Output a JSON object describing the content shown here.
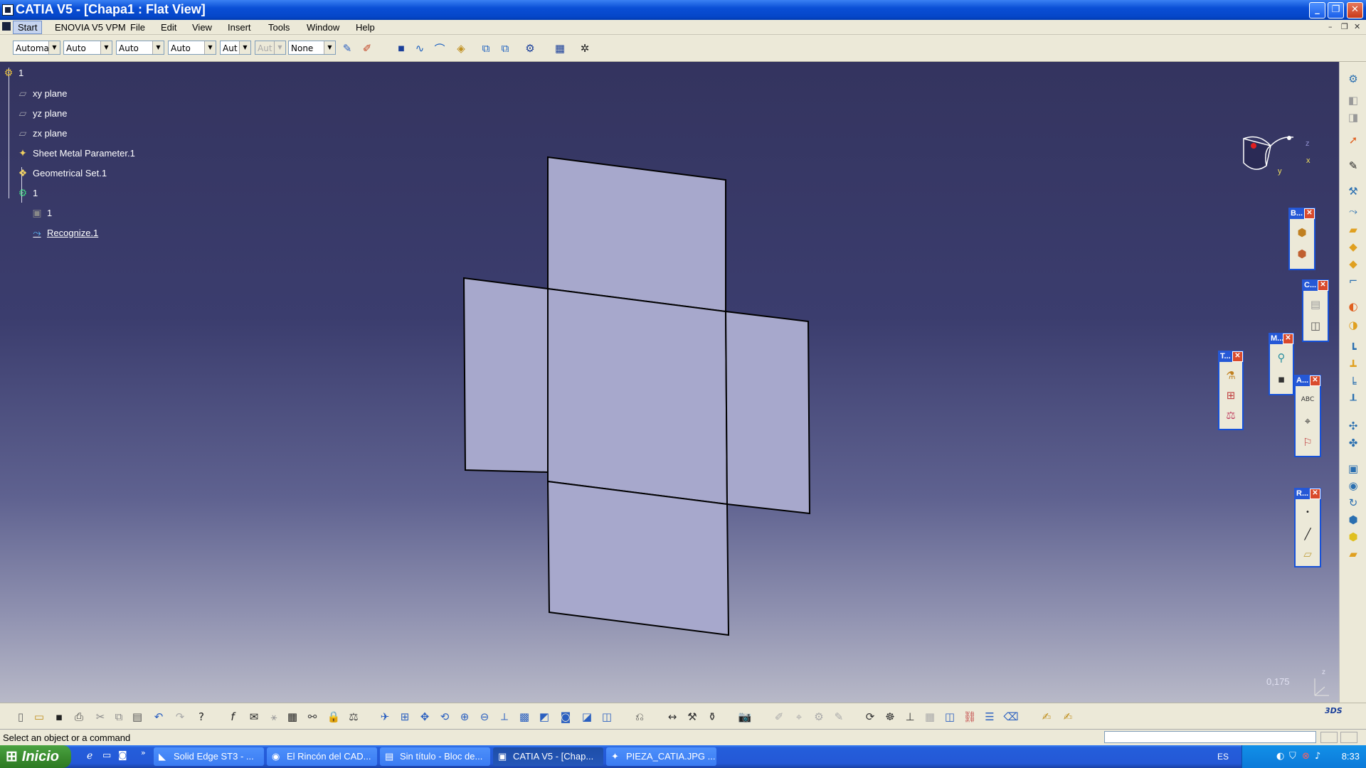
{
  "window": {
    "title": "CATIA V5 - [Chapa1 : Flat View]"
  },
  "menu": {
    "items": [
      "Start",
      "ENOVIA V5 VPM",
      "File",
      "Edit",
      "View",
      "Insert",
      "Tools",
      "Window",
      "Help"
    ]
  },
  "toolbar": {
    "combos": [
      "Automa",
      "Auto",
      "Auto",
      "Auto",
      "Aut",
      "Aut",
      "None"
    ]
  },
  "tree": {
    "root": "1",
    "items": [
      "xy plane",
      "yz plane",
      "zx plane",
      "Sheet Metal Parameter.1",
      "Geometrical Set.1",
      "1",
      "1",
      "Recognize.1"
    ]
  },
  "compass": {
    "x": "x",
    "y": "y",
    "z": "z"
  },
  "palettes": [
    {
      "label": "B..."
    },
    {
      "label": "C..."
    },
    {
      "label": "M..."
    },
    {
      "label": "T..."
    },
    {
      "label": "A..."
    },
    {
      "label": "R..."
    }
  ],
  "viewport": {
    "scale": "0,175",
    "triad_z": "z"
  },
  "status": {
    "text": "Select an object or a command"
  },
  "taskbar": {
    "start": "Inicio",
    "tasks": [
      "Solid Edge ST3 - ...",
      "El Rincón del CAD...",
      "Sin título - Bloc de...",
      "CATIA V5 - [Chap...",
      "PIEZA_CATIA.JPG ..."
    ],
    "lang": "ES",
    "clock": "8:33"
  },
  "colors": {
    "viewport_top": "#34345f",
    "viewport_bottom": "#b8b9c8",
    "part_fill": "#a7a8cc",
    "titlebar": "#0a4fd6"
  }
}
